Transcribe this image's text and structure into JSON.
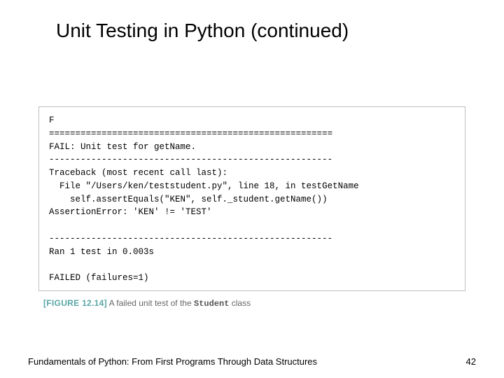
{
  "title": "Unit Testing in Python (continued)",
  "code": {
    "l1": "F",
    "l2": "======================================================",
    "l3": "FAIL: Unit test for getName.",
    "l4": "------------------------------------------------------",
    "l5": "Traceback (most recent call last):",
    "l6": "  File \"/Users/ken/teststudent.py\", line 18, in testGetName",
    "l7": "    self.assertEquals(\"KEN\", self._student.getName())",
    "l8": "AssertionError: 'KEN' != 'TEST'",
    "l9": "",
    "l10": "------------------------------------------------------",
    "l11": "Ran 1 test in 0.003s",
    "l12": "",
    "l13": "FAILED (failures=1)"
  },
  "figure": {
    "label": "[FIGURE 12.14]",
    "text_before": " A failed unit test of the ",
    "class_name": "Student",
    "text_after": " class"
  },
  "footer": {
    "left": "Fundamentals of Python: From First Programs Through Data Structures",
    "right": "42"
  }
}
